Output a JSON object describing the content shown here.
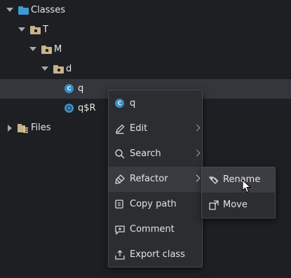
{
  "tree": {
    "classes_label": "Classes",
    "pkg_t": "T",
    "pkg_m": "M",
    "pkg_d": "d",
    "class_q": "q",
    "class_q_inner": "q$R",
    "files_label": "Files"
  },
  "context_menu": {
    "header": "q",
    "edit": "Edit",
    "search": "Search",
    "refactor": "Refactor",
    "copy_path": "Copy path",
    "comment": "Comment",
    "export": "Export class"
  },
  "refactor_submenu": {
    "rename": "Rename",
    "move": "Move"
  },
  "colors": {
    "background": "#1e1f22",
    "menu_bg": "#2b2d30",
    "class_icon": "#3b8fc4",
    "classes_folder": "#3b9bd5",
    "package_folder": "#c9b28a"
  }
}
